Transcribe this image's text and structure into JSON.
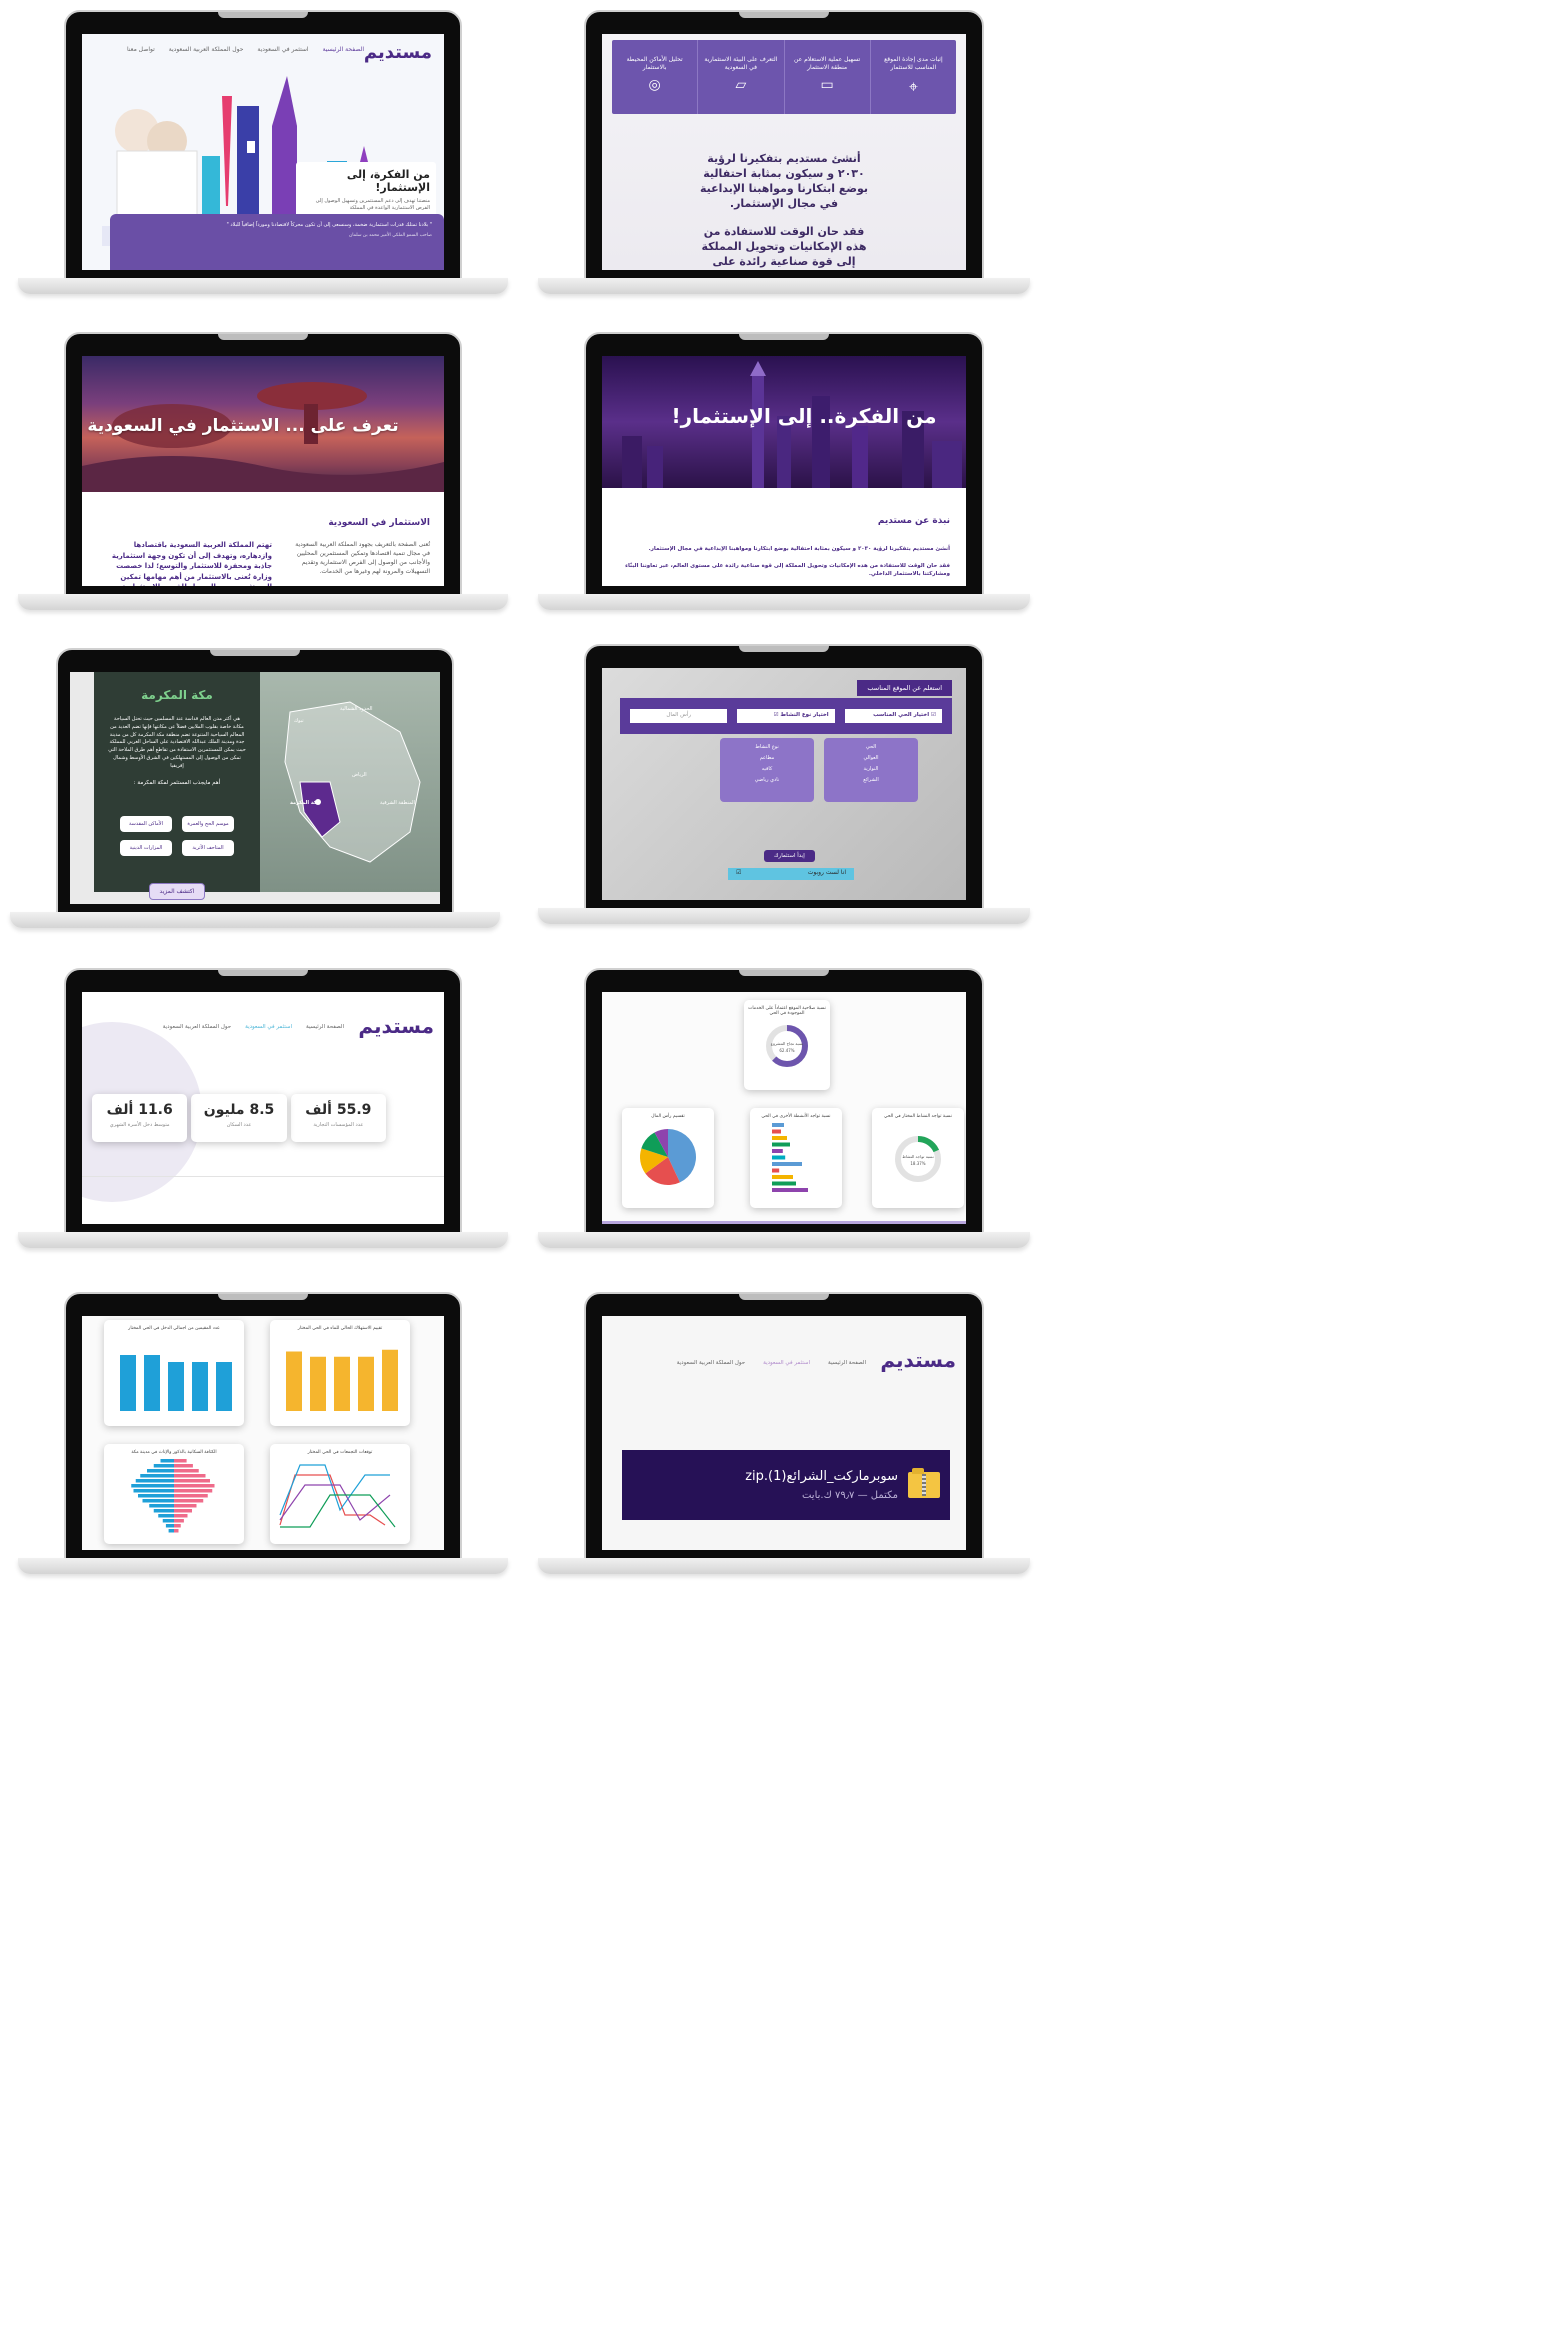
{
  "brand": {
    "logo": "مستديم",
    "purple": "#5d3a9b",
    "dark_purple": "#2a0f5c"
  },
  "nav": {
    "home": "الصفحة الرئيسية",
    "invest": "استثمر في السعودية",
    "about": "حول المملكة العربية السعودية",
    "contact": "تواصل معنا"
  },
  "screen1": {
    "headline": "من الفكرة، إلى الإستثمار!",
    "body": "منصتنا تهدف إلى دعم المستثمرين وتسهيل الوصول إلى الفرص الاستثمارية الواعدة في المملكة",
    "quote": "\" بلادنا تمتلك قدرات استثمارية ضخمة، وسنسعى إلى أن تكون محركاً لاقتصادنا ومورداً إضافياً للبلاد \"",
    "quote_author": "صاحب السمو الملكي الأمير محمد بن سلمان"
  },
  "screen2": {
    "features": [
      "إثبات مدى إجادة الموقع المناسب للاستثمار",
      "تسهيل عملية الاستعلام عن منطقة الاستثمار",
      "التعرف على البيئة الاستثمارية في السعودية",
      "تحليل الأماكن المحيطة بالاستثمار"
    ],
    "para1": "أنشئ مستديم بتفكيرنا لرؤية ٢٠٣٠ و سيكون بمثابة احتفالية بوضع ابتكارنا ومواهبنا الإبداعية في مجال الإستثمار.",
    "para2": "فقد حان الوقت للاستفادة من هذه الإمكانيات وتحويل المملكة إلى قوة صناعية رائدة على مستوى العالم، عبر تعاوننا البنّاء ومشاركتنا بالاستثمار الداخلي."
  },
  "screen3": {
    "hero": "تعرف على ... الاستثمار في السعودية",
    "section_title": "الاستثمار في السعودية",
    "col1": "تُعنى الصفحة بالتعريف بجهود المملكة العربية السعودية في مجال تنمية اقتصادها وتمكين المستثمرين المحليين والأجانب من الوصول إلى الفرص الاستثمارية وتقديم التسهيلات والمرونة لهم وغيرها من الخدمات.",
    "col2": "تهتم المملكة العربية السعودية باقتصادها وازدهاره، وتهدف إلى أن تكون وجهة استثمارية جاذبة ومحفزة للاستثمار والتوسع؛ لذا خصصت وزارة تُعنى بالاستثمار من أهم مهامها تمكين المستثمرين من الوصول للفرص الاستثمارية، وتقديم التسهيلات والمرونة لهم وغيرها من الخدمات."
  },
  "screen4": {
    "hero": "من الفكرة.. إلى الإستثمار!",
    "section_title": "نبذة عن مستديم",
    "para1": "أنشئ مستديم بتفكيرنا لرؤية ٢٠٣٠ و سيكون بمثابة احتفالية بوضع ابتكارنا ومواهبنا الإبداعية في مجال الإستثمار.",
    "para2": "فقد حان الوقت للاستفادة من هذه الإمكانيات وتحويل المملكة إلى قوة صناعية رائدة على مستوى العالم، عبر تعاوننا البنّاء ومشاركتنا بالاستثمار الداخلي."
  },
  "screen5": {
    "title": "مكة المكرمة",
    "body": "هي أكثر مدن العالم قداسة عند المسلمين حيث تحتل السياحة مكانة خاصة بقلوب الملايين فضلاً عن مكانتها فإنها تضم العديد من المعالم السياحية المتنوعة تضم منطقة مكة المكرمة كل من مدينة جدة ومدينة الملك عبدالله الاقتصادية على الساحل الغربي للمملكة حيث يمكن للمستثمرين الاستفادة من تقاطع أهم طرق الملاحة التي تمكن من الوصول إلى المستهلكين في الشرق الأوسط وشمال إفريقيا",
    "subtitle": "أهم مايجذب المستثمر لمكة المكرمة :",
    "tags": [
      "موسم الحج والعمرة",
      "الأماكن المقدسة",
      "المتاحف الأثرية",
      "المزارات الدينية"
    ],
    "button": "اكتشف المزيد",
    "map_labels": [
      "الحدود الشمالية",
      "الجوف",
      "تبوك",
      "حائل",
      "القصيم",
      "المدينة",
      "الرياض",
      "المنطقة الشرقية",
      "مكة المكرمة",
      "الباحة",
      "عسير",
      "جازان",
      "نجران"
    ]
  },
  "screen6": {
    "header": "استعلم عن الموقع المناسب",
    "district_select": "اختيار الحي المناسب",
    "activity_select": "اختيار نوع النشاط",
    "capital_placeholder": "رأس المال",
    "district_options": [
      "الحي",
      "العوالي",
      "الشرائع",
      "النوارية"
    ],
    "activity_options": [
      "نوع النشاط",
      "مطاعم",
      "كافيه",
      "نادي رياضي"
    ],
    "start_button": "إبدأ استثمارك",
    "captcha": "انا لست روبوت"
  },
  "screen7": {
    "stats": [
      {
        "value": "55.9 ألف",
        "label": "عدد المؤسسات التجارية"
      },
      {
        "value": "8.5 مليون",
        "label": "عدد السكان"
      },
      {
        "value": "11.6 ألف",
        "label": "متوسط دخل الأسرة الشهري"
      }
    ]
  },
  "screen8": {
    "donut_top": {
      "title": "نسبة صلاحية الموقع اعتماداً على الخدمات الموجودة في الحي",
      "label": "نسبة نجاح المشروع",
      "value": "62.47%",
      "fraction": 0.6247
    },
    "donut_right": {
      "title": "نسبة تواجد النشاط المختار في الحي",
      "label": "نسبة تواجد النشاط",
      "value": "18.37%",
      "fraction": 0.1837
    },
    "bars_title": "نسبة تواجد الأنشطة الأخرى في الحي",
    "pie_title": "تقسيم رأس المال",
    "colors": [
      "#5b9bd5",
      "#e64f4f",
      "#f4b400",
      "#0f9d58",
      "#8e44ad",
      "#00acc1"
    ]
  },
  "screen9": {
    "chart1_title": "تقييم الاستهلاك الحالي للماء في الحي المختار",
    "chart2_title": "عدد المقيمين من اجمالي الدخل في الحي المختار",
    "chart3_title": "توقعات التجمعات في الحي المختار",
    "chart4_title": "الكثافة السكانية بالذكور والإناث في مدينة مكة",
    "yellow_values": [
      3.4,
      3.1,
      3.1,
      3.1,
      3.5
    ],
    "blue_values": [
      5600,
      5600,
      4900,
      4900,
      4900
    ],
    "pyramid_left": [
      0.3,
      0.45,
      0.6,
      0.75,
      0.85,
      0.95,
      0.9,
      0.8,
      0.7,
      0.55,
      0.45,
      0.35,
      0.25,
      0.18,
      0.12
    ],
    "pyramid_right": [
      0.28,
      0.42,
      0.55,
      0.7,
      0.8,
      0.9,
      0.85,
      0.75,
      0.65,
      0.5,
      0.4,
      0.3,
      0.22,
      0.15,
      0.1
    ]
  },
  "screen10": {
    "file_name": "سوبرماركت_الشرائع(1).zip",
    "file_status": "مكتمل — ٧٩٫٧ ك.بايت"
  }
}
